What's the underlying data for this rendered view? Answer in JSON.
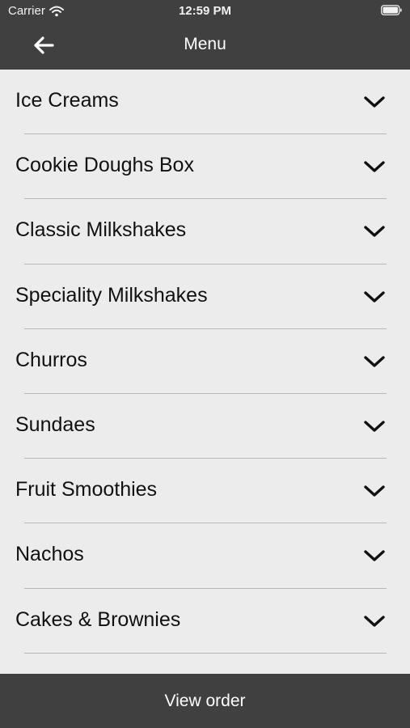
{
  "status_bar": {
    "carrier": "Carrier",
    "time": "12:59 PM",
    "icons": [
      "wifi-icon",
      "battery-icon"
    ]
  },
  "nav": {
    "title": "Menu",
    "back_icon": "arrow-left-icon"
  },
  "menu": {
    "items": [
      {
        "label": "Ice Creams",
        "icon": "chevron-down-icon"
      },
      {
        "label": "Cookie Doughs Box",
        "icon": "chevron-down-icon"
      },
      {
        "label": "Classic Milkshakes",
        "icon": "chevron-down-icon"
      },
      {
        "label": "Speciality Milkshakes",
        "icon": "chevron-down-icon"
      },
      {
        "label": "Churros",
        "icon": "chevron-down-icon"
      },
      {
        "label": "Sundaes",
        "icon": "chevron-down-icon"
      },
      {
        "label": "Fruit Smoothies",
        "icon": "chevron-down-icon"
      },
      {
        "label": "Nachos",
        "icon": "chevron-down-icon"
      },
      {
        "label": "Cakes & Brownies",
        "icon": "chevron-down-icon"
      }
    ]
  },
  "footer": {
    "view_order_label": "View order"
  },
  "colors": {
    "bar_background": "#404040",
    "list_background": "#ececec",
    "divider": "#b9b9b9",
    "bar_text": "#ffffff"
  }
}
